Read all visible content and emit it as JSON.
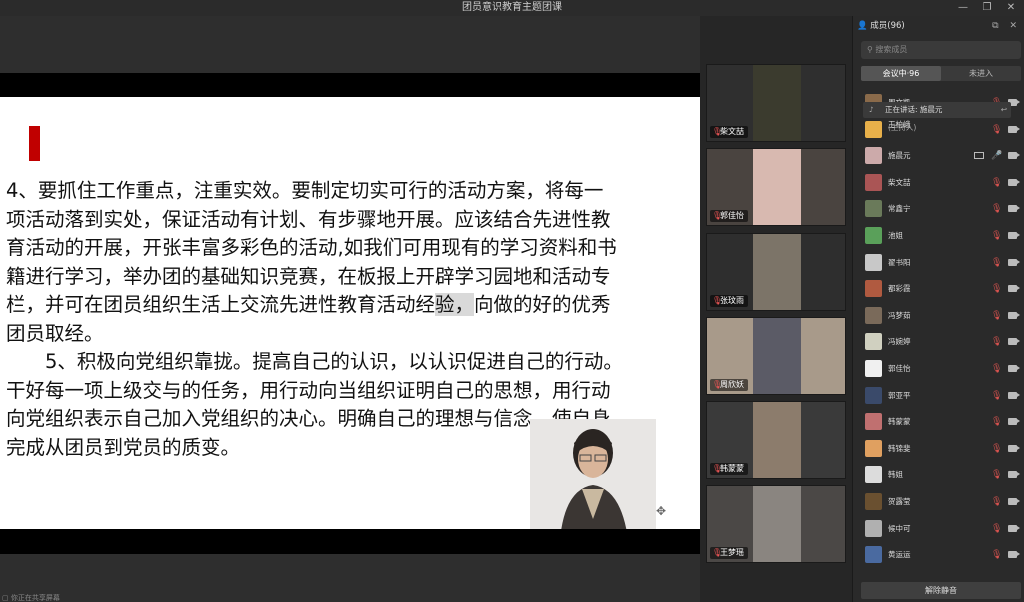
{
  "window": {
    "title": "团员意识教育主题团课",
    "controls": [
      "—",
      "❐",
      "✕"
    ]
  },
  "slide": {
    "lines": [
      "4、要抓住工作重点，注重实效。要制定切实可行的活动方案，将每一",
      "项活动落到实处，保证活动有计划、有步骤地开展。应该结合先进性教",
      "育活动的开展，开张丰富多彩色的活动,如我们可用现有的学习资料和书",
      "籍进行学习，举办团的基础知识竞赛，在板报上开辟学习园地和活动专",
      "栏，并可在团员组织生活上交流先进性教育活动经验，向做的好的优秀",
      "团员取经。",
      "　　5、积极向党组织靠拢。提高自己的认识，以认识促进自己的行动。",
      "干好每一项上级交与的任务，用行动向当组织证明自己的思想，用行动",
      "向党组织表示自己加入党组织的决心。明确自己的理想与信念，使自身",
      "完成从团员到党员的质变。"
    ],
    "highlight_text": "验，",
    "accent_color": "#c00000"
  },
  "bottom_status": "▢ 你正在共享屏幕",
  "videos": [
    {
      "name": "柴文喆",
      "bg": "#2f2f2f",
      "cam": "#3b3b2e"
    },
    {
      "name": "郭佳怡",
      "bg": "#4a4440",
      "cam": "#d8b9b0"
    },
    {
      "name": "张玟雨",
      "bg": "#2e2e2e",
      "cam": "#7c7468"
    },
    {
      "name": "周欣妖",
      "bg": "#a89a8a",
      "cam": "#5b5b66"
    },
    {
      "name": "韩蒙蒙",
      "bg": "#3a3a3a",
      "cam": "#8c7c6c"
    },
    {
      "name": "王梦瑶",
      "bg": "#4b4846",
      "cam": "#8a8580"
    }
  ],
  "members": {
    "header": "成员(96)",
    "header_icons": "⧉ ✕",
    "search_placeholder": "搜索成员",
    "tabs": [
      "会议中·96",
      "未进入"
    ],
    "speaking": "正在讲话: 施晨元",
    "rows": [
      {
        "name": "周文凯",
        "sub": "",
        "mic": "off",
        "color": "#8a6a4a"
      },
      {
        "name": "王柏峨",
        "sub": "(主持人)",
        "mic": "off",
        "color": "#e8b04a"
      },
      {
        "name": "施晨元",
        "sub": "",
        "mic": "on",
        "share": true,
        "color": "#caa"
      },
      {
        "name": "柴文喆",
        "sub": "",
        "mic": "off",
        "color": "#a55"
      },
      {
        "name": "常鑫宁",
        "sub": "",
        "mic": "off",
        "color": "#6a7a5a"
      },
      {
        "name": "池姐",
        "sub": "",
        "mic": "off",
        "color": "#5aa05a"
      },
      {
        "name": "翟书阳",
        "sub": "",
        "mic": "off",
        "color": "#c8c8c8"
      },
      {
        "name": "都彩霞",
        "sub": "",
        "mic": "off",
        "color": "#b05a40"
      },
      {
        "name": "冯梦茹",
        "sub": "",
        "mic": "off",
        "color": "#7a6a5a"
      },
      {
        "name": "冯婉婷",
        "sub": "",
        "mic": "off",
        "color": "#d0d0c0"
      },
      {
        "name": "郭佳怡",
        "sub": "",
        "mic": "off",
        "color": "#f0f0f0"
      },
      {
        "name": "郭亚平",
        "sub": "",
        "mic": "off",
        "color": "#3a4a6a"
      },
      {
        "name": "韩蒙蒙",
        "sub": "",
        "mic": "off",
        "color": "#c07070"
      },
      {
        "name": "韩锦斐",
        "sub": "",
        "mic": "off",
        "color": "#e0a060"
      },
      {
        "name": "韩姐",
        "sub": "",
        "mic": "off",
        "color": "#dcdcdc"
      },
      {
        "name": "贺露莹",
        "sub": "",
        "mic": "off",
        "color": "#6a5030"
      },
      {
        "name": "候中可",
        "sub": "",
        "mic": "off",
        "color": "#b0b0b0"
      },
      {
        "name": "黄运运",
        "sub": "",
        "mic": "off",
        "color": "#4a6aa0"
      }
    ],
    "unmute_label": "解除静音"
  }
}
